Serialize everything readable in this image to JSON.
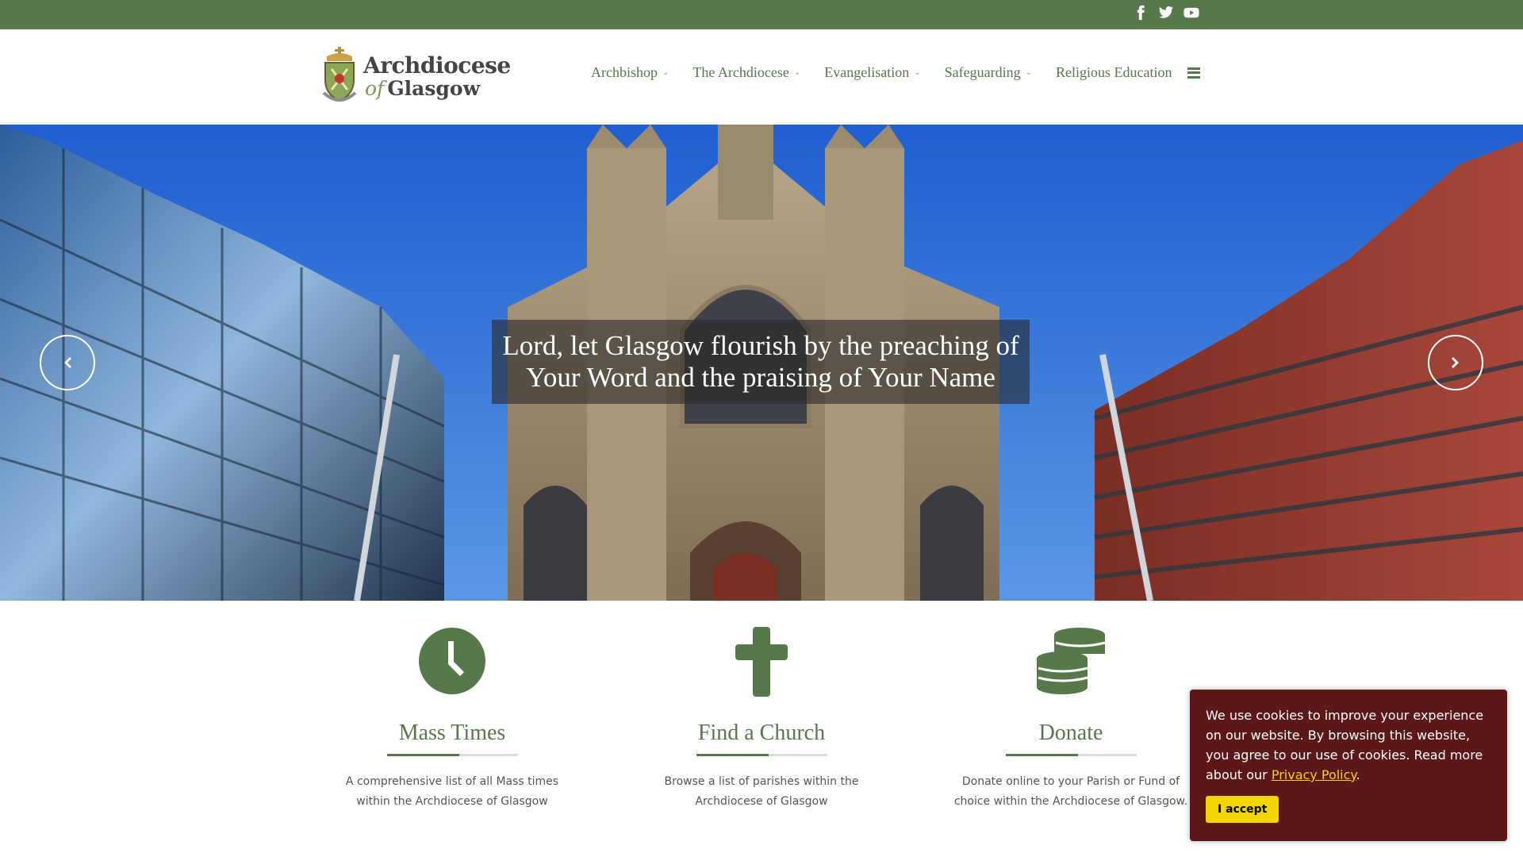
{
  "topbar": {
    "social": [
      {
        "icon": "facebook-icon",
        "label": "f"
      },
      {
        "icon": "twitter-icon",
        "label": "twitter"
      },
      {
        "icon": "youtube-icon",
        "label": "youtube"
      }
    ],
    "color": "#56784b"
  },
  "header": {
    "logo_line1": "Archdiocese",
    "logo_of": "of",
    "logo_line2": "Glasgow",
    "nav": [
      {
        "label": "Archbishop",
        "has_dropdown": true
      },
      {
        "label": "The Archdiocese",
        "has_dropdown": true
      },
      {
        "label": "Evangelisation",
        "has_dropdown": true
      },
      {
        "label": "Safeguarding",
        "has_dropdown": true
      },
      {
        "label": "Religious Education",
        "has_dropdown": false
      }
    ],
    "menu_icon": "hamburger-icon"
  },
  "hero": {
    "caption": "Lord, let Glasgow flourish by the preaching of Your Word and the praising of Your Name",
    "prev_icon": "chevron-left-icon",
    "next_icon": "chevron-right-icon"
  },
  "features": [
    {
      "icon": "clock-icon",
      "title": "Mass Times",
      "description": "A comprehensive list of all Mass times within the Archdiocese of Glasgow"
    },
    {
      "icon": "cross-icon",
      "title": "Find a Church",
      "description": "Browse a list of parishes within the Archdiocese of Glasgow"
    },
    {
      "icon": "coins-icon",
      "title": "Donate",
      "description": "Donate online to your Parish or Fund of choice within the Archdiocese of Glasgow."
    }
  ],
  "cookie": {
    "text_before": "We use cookies to improve your experience on our website. By browsing this website, you agree to our use of cookies. Read more about our ",
    "link": "Privacy Policy",
    "text_after": ".",
    "button": "I accept",
    "bg_color": "#5c1719",
    "accent_color": "#f1d600"
  }
}
